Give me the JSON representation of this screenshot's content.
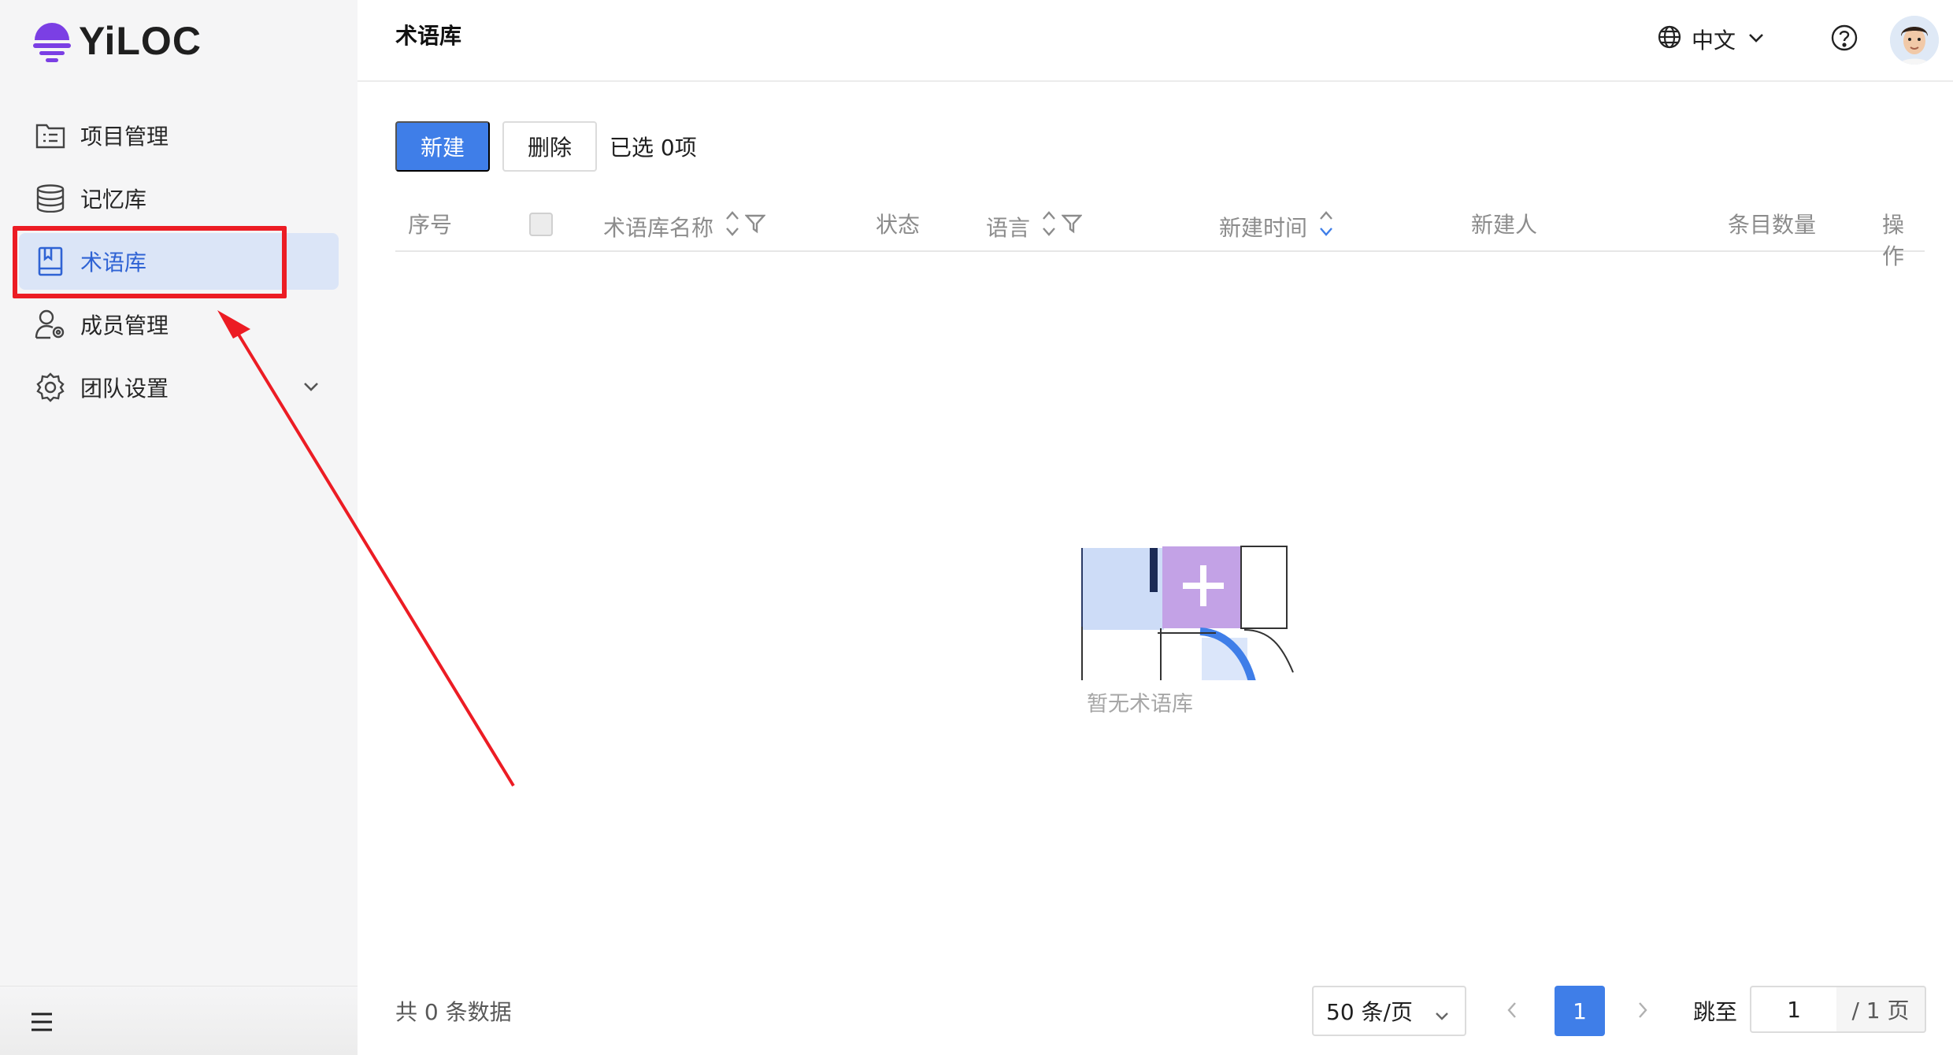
{
  "app": {
    "logo_text": "YiLOC"
  },
  "sidebar": {
    "items": [
      {
        "label": "项目管理",
        "icon": "project-list-icon"
      },
      {
        "label": "记忆库",
        "icon": "database-icon"
      },
      {
        "label": "术语库",
        "icon": "book-icon",
        "active": true
      },
      {
        "label": "成员管理",
        "icon": "member-settings-icon"
      },
      {
        "label": "团队设置",
        "icon": "gear-icon",
        "expandable": true
      }
    ],
    "menu_toggle_icon": "hamburger-icon"
  },
  "header": {
    "title": "术语库",
    "language": "中文",
    "help_icon": "help-circle-icon"
  },
  "toolbar": {
    "new_label": "新建",
    "delete_label": "删除",
    "selected_text": "已选 0项"
  },
  "table": {
    "columns": {
      "index": "序号",
      "name": "术语库名称",
      "status": "状态",
      "language": "语言",
      "created_time": "新建时间",
      "creator": "新建人",
      "entry_count": "条目数量",
      "actions": "操作"
    },
    "rows": [],
    "empty_text": "暂无术语库"
  },
  "pagination": {
    "total_text": "共 0 条数据",
    "page_size": "50 条/页",
    "current_page": "1",
    "jump_label": "跳至",
    "jump_value": "1",
    "total_pages": "/ 1 页"
  },
  "colors": {
    "primary": "#3f7ee8",
    "active_bg": "#dbe5f7",
    "annotation": "#ec1c24",
    "logo_purple": "#7b3fe4"
  }
}
